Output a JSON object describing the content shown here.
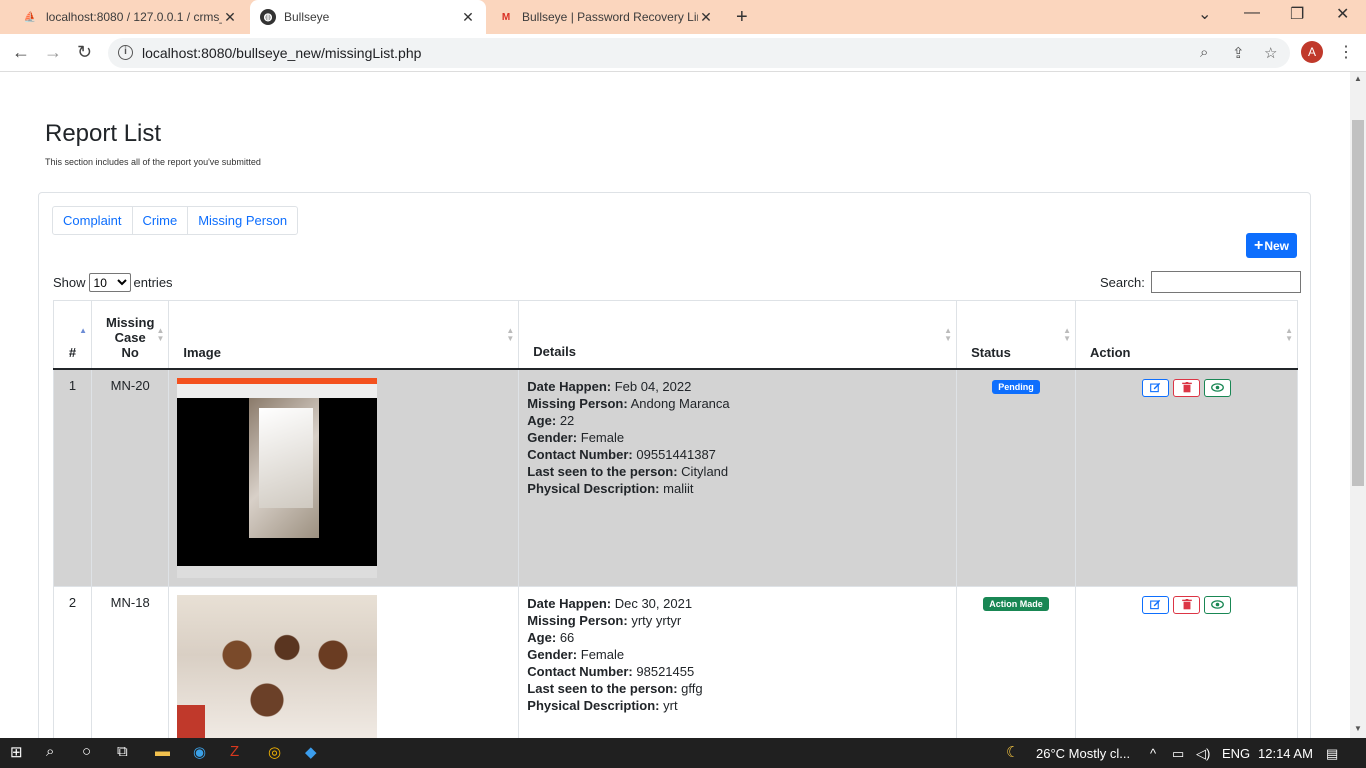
{
  "browser": {
    "tabs": [
      {
        "title": "localhost:8080 / 127.0.0.1 / crms_",
        "favicon": "phpmyadmin-icon"
      },
      {
        "title": "Bullseye",
        "favicon": "globe-icon"
      },
      {
        "title": "Bullseye | Password Recovery Link",
        "favicon": "gmail-icon"
      }
    ],
    "url": "localhost:8080/bullseye_new/missingList.php",
    "profile_initial": "A"
  },
  "page": {
    "title": "Report List",
    "subtitle": "This section includes all of the report you've submitted"
  },
  "tabs": [
    "Complaint",
    "Crime",
    "Missing Person"
  ],
  "new_button": "New",
  "show": {
    "prefix": "Show",
    "value": "10",
    "suffix": "entries"
  },
  "search_label": "Search:",
  "columns": [
    "#",
    "Missing Case No",
    "Image",
    "Details",
    "Status",
    "Action"
  ],
  "detail_labels": {
    "date": "Date Happen:",
    "person": "Missing Person:",
    "age": "Age:",
    "gender": "Gender:",
    "contact": "Contact Number:",
    "last_seen": "Last seen to the person:",
    "description": "Physical Description:"
  },
  "rows": [
    {
      "num": "1",
      "case_no": "MN-20",
      "date": "Feb 04, 2022",
      "person": "Andong Maranca",
      "age": "22",
      "gender": "Female",
      "contact": "09551441387",
      "last_seen": "Cityland",
      "description": "maliit",
      "status": "Pending",
      "status_color": "#0d6efd"
    },
    {
      "num": "2",
      "case_no": "MN-18",
      "date": "Dec 30, 2021",
      "person": "yrty yrtyr",
      "age": "66",
      "gender": "Female",
      "contact": "98521455",
      "last_seen": "gffg",
      "description": "yrt",
      "status": "Action Made",
      "status_color": "#198754"
    }
  ],
  "taskbar": {
    "weather": "26°C  Mostly cl...",
    "lang": "ENG",
    "time": "12:14 AM"
  }
}
